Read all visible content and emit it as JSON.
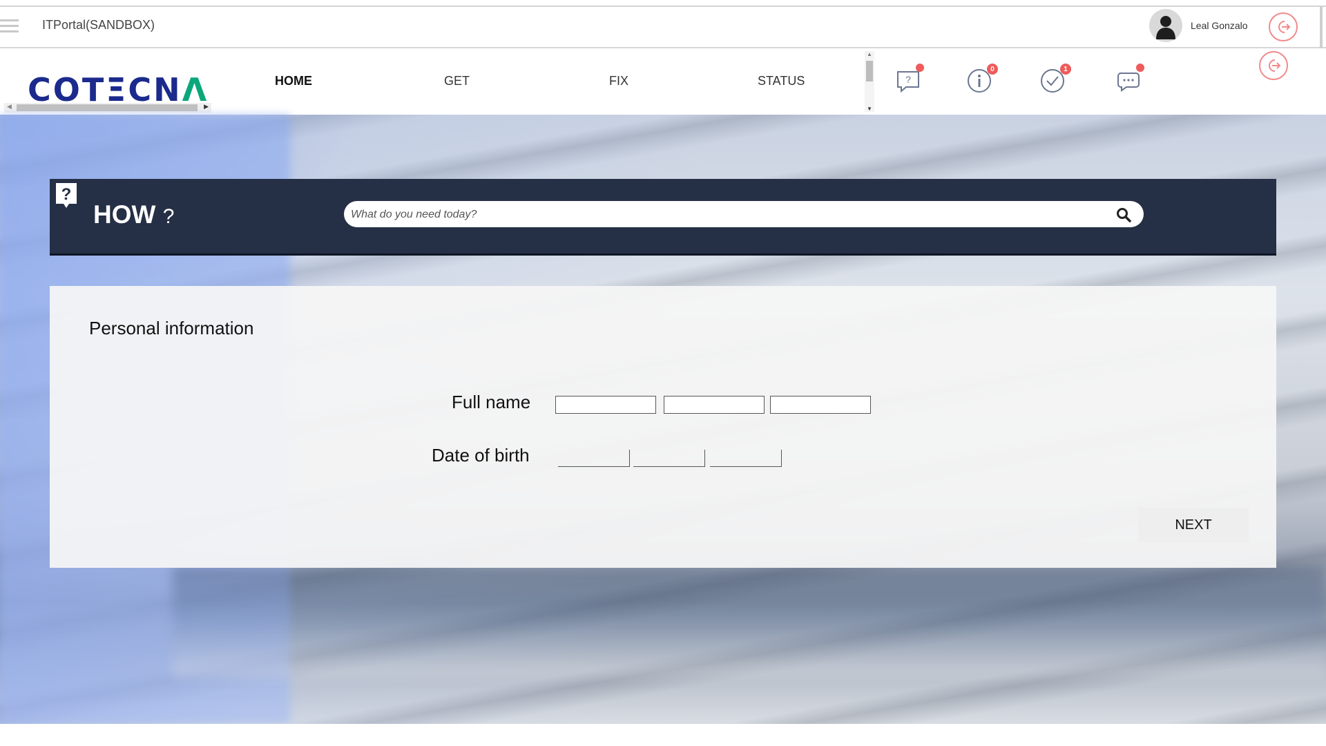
{
  "header": {
    "app_title": "ITPortal(SANDBOX)",
    "user_name": "Leal Gonzalo"
  },
  "nav": {
    "logo_text_left": "COT",
    "logo_text_e": "Ξ",
    "logo_text_right": "CN",
    "logo_text_a": "Λ",
    "items": [
      "HOME",
      "GET",
      "FIX",
      "STATUS"
    ],
    "active": "HOME",
    "icons": [
      {
        "name": "help-icon",
        "badge": ""
      },
      {
        "name": "info-icon",
        "badge": "0"
      },
      {
        "name": "check-icon",
        "badge": "1"
      },
      {
        "name": "chat-icon",
        "badge": ""
      }
    ]
  },
  "how": {
    "title": "HOW",
    "title_suffix": "?",
    "search_placeholder": "What do you need today?"
  },
  "form": {
    "section_title": "Personal information",
    "full_name_label": "Full name",
    "dob_label": "Date of birth",
    "next_label": "NEXT"
  },
  "colors": {
    "brand_blue": "#1b2a8c",
    "brand_green": "#0aa77a",
    "how_bar": "#252f45",
    "badge": "#ef5b5b",
    "logout": "#f08a8a"
  }
}
